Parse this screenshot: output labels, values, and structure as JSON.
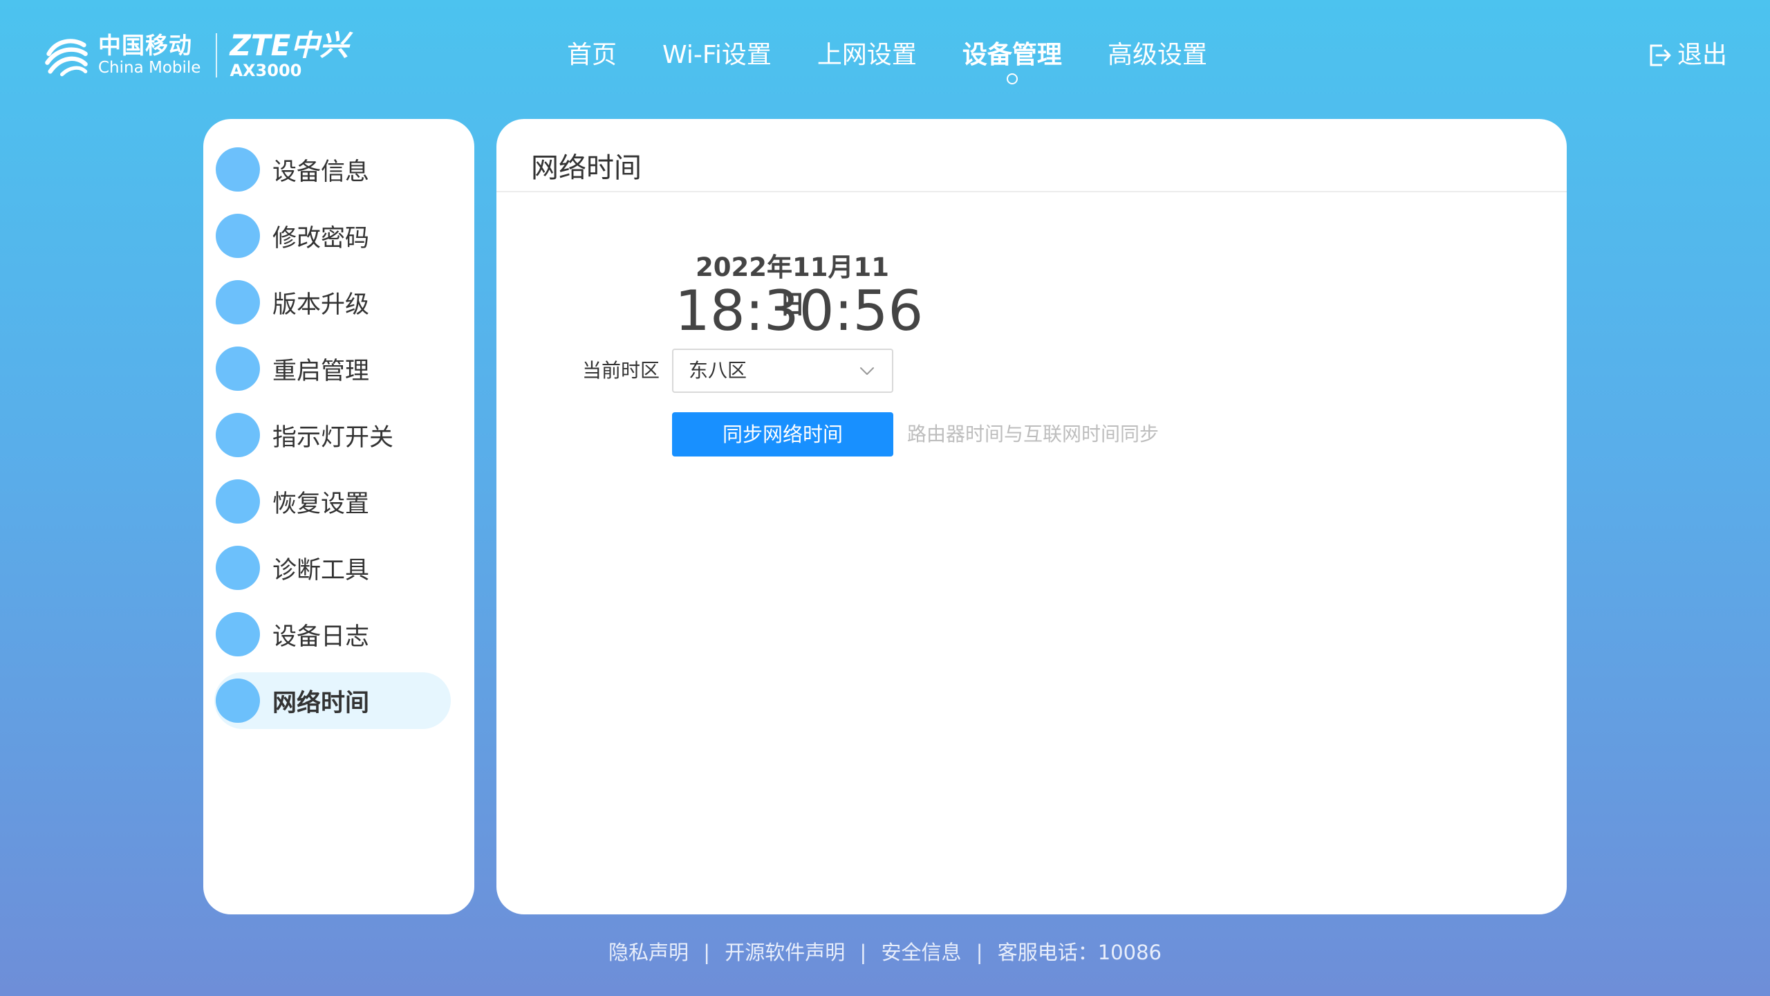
{
  "header": {
    "brand_cn": "中国移动",
    "brand_en": "China Mobile",
    "zte_brand": "ZTE中兴",
    "model": "AX3000",
    "nav": [
      {
        "label": "首页"
      },
      {
        "label": "Wi-Fi设置"
      },
      {
        "label": "上网设置"
      },
      {
        "label": "设备管理"
      },
      {
        "label": "高级设置"
      }
    ],
    "active_nav": "设备管理",
    "logout_label": "退出"
  },
  "sidebar": {
    "items": [
      {
        "label": "设备信息"
      },
      {
        "label": "修改密码"
      },
      {
        "label": "版本升级"
      },
      {
        "label": "重启管理"
      },
      {
        "label": "指示灯开关"
      },
      {
        "label": "恢复设置"
      },
      {
        "label": "诊断工具"
      },
      {
        "label": "设备日志"
      },
      {
        "label": "网络时间"
      }
    ],
    "active_item": "网络时间"
  },
  "main": {
    "title": "网络时间",
    "date": "2022年11月11日",
    "time": "18:30:56",
    "timezone_label": "当前时区",
    "timezone_value": "东八区",
    "sync_button": "同步网络时间",
    "sync_hint": "路由器时间与互联网时间同步"
  },
  "footer": {
    "privacy": "隐私声明",
    "opensource": "开源软件声明",
    "security": "安全信息",
    "hotline": "客服电话：10086",
    "separator": "|"
  },
  "colors": {
    "gradient_top": "#4cc3ef",
    "gradient_bottom": "#6e8ed8",
    "accent_button": "#1890ff",
    "sidebar_circle": "#6cc0fb",
    "sidebar_active_bg": "#e6f6fe"
  },
  "icons": {
    "brand": "china-mobile-logo-icon",
    "logout": "logout-icon",
    "dropdown": "chevron-down-icon"
  }
}
